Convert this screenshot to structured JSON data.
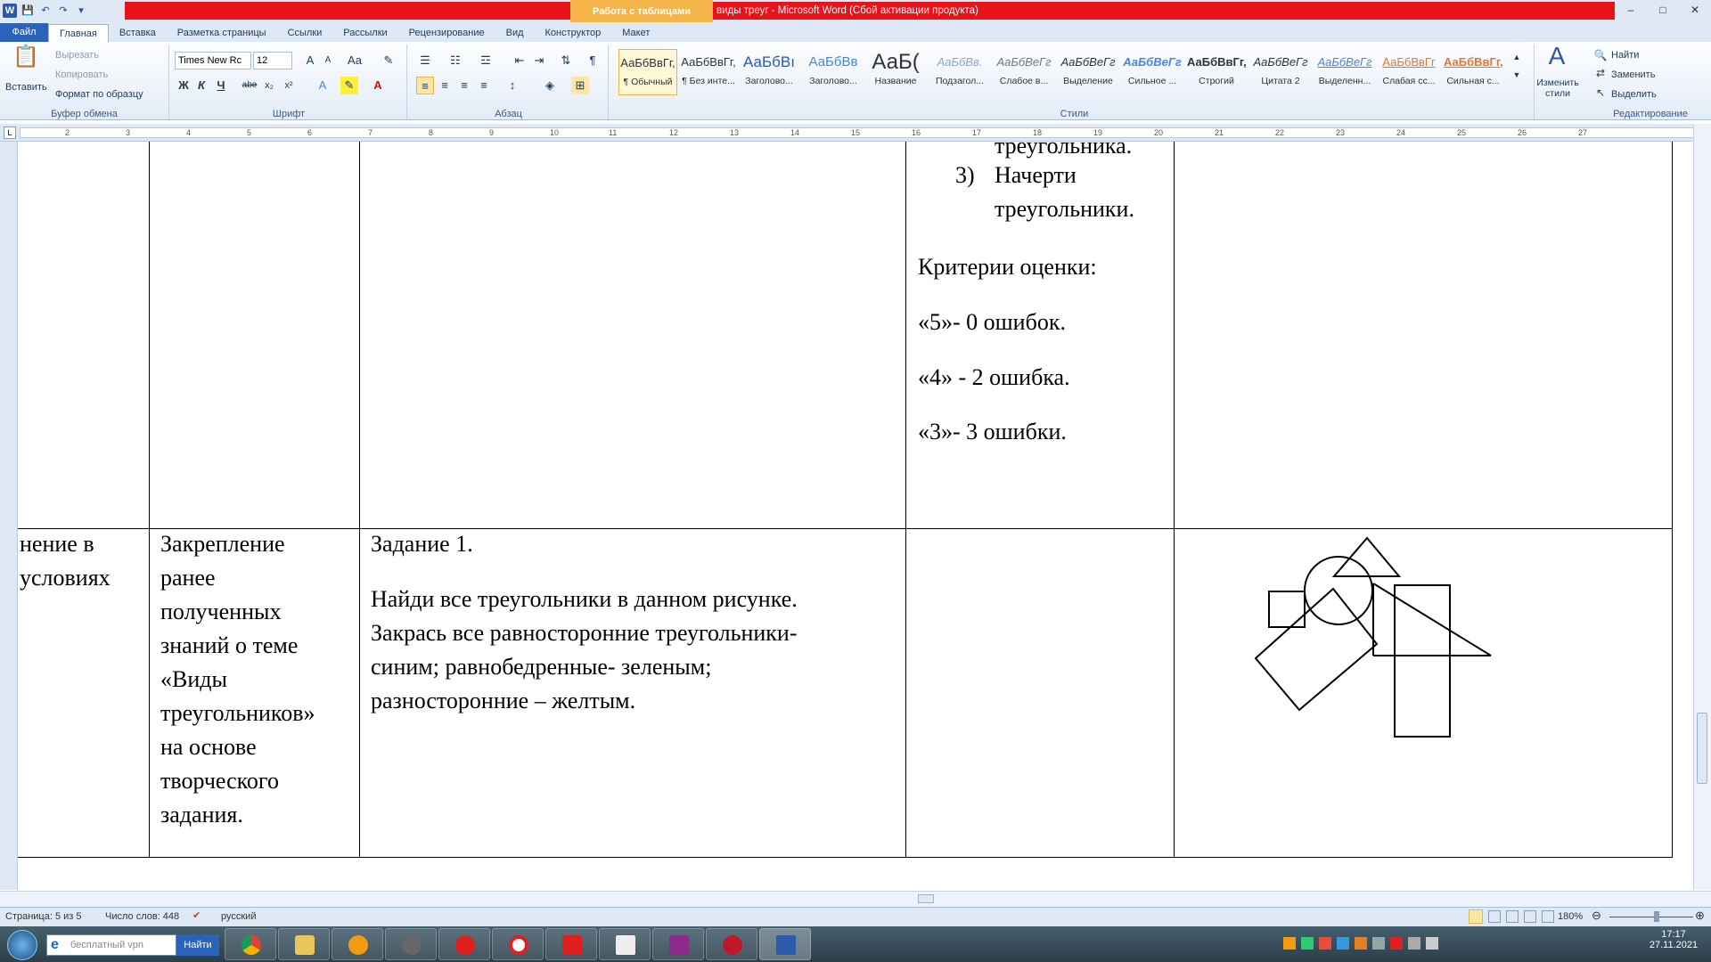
{
  "window": {
    "context_tab": "Работа с таблицами",
    "title": "виды треуг  -  Microsoft Word (Сбой активации продукта)",
    "controls": {
      "minimize": "–",
      "maximize": "□",
      "close": "✕"
    }
  },
  "ribbon_tabs": [
    "Файл",
    "Главная",
    "Вставка",
    "Разметка страницы",
    "Ссылки",
    "Рассылки",
    "Рецензирование",
    "Вид",
    "Конструктор",
    "Макет"
  ],
  "clipboard": {
    "paste": "Вставить",
    "cut": "Вырезать",
    "copy": "Копировать",
    "format_painter": "Формат по образцу",
    "label": "Буфер обмена"
  },
  "font": {
    "name": "Times New Rc",
    "size": "12",
    "label": "Шрифт",
    "bold": "Ж",
    "italic": "К",
    "underline": "Ч",
    "strike": "abe",
    "sub": "x₂",
    "sup": "x²"
  },
  "paragraph": {
    "label": "Абзац"
  },
  "styles": {
    "label": "Стили",
    "items": [
      {
        "preview": "АаБбВвГг,",
        "name": "¶ Обычный"
      },
      {
        "preview": "АаБбВвГг,",
        "name": "¶ Без инте..."
      },
      {
        "preview": "АаБбВı",
        "name": "Заголово..."
      },
      {
        "preview": "АаБбВв",
        "name": "Заголово..."
      },
      {
        "preview": "АаБ(",
        "name": "Название"
      },
      {
        "preview": "АаБбВв.",
        "name": "Подзагол..."
      },
      {
        "preview": "АаБбВеГг",
        "name": "Слабое в..."
      },
      {
        "preview": "АаБбВеГг",
        "name": "Выделение"
      },
      {
        "preview": "АаБбВеГг",
        "name": "Сильное ..."
      },
      {
        "preview": "АаБбВвГг,",
        "name": "Строгий"
      },
      {
        "preview": "АаБбВеГг",
        "name": "Цитата 2"
      },
      {
        "preview": "АаБбВеГг",
        "name": "Выделенн..."
      },
      {
        "preview": "АаБбВвГг",
        "name": "Слабая сс..."
      },
      {
        "preview": "АаБбВвГг,",
        "name": "Сильная с..."
      }
    ],
    "change": "Изменить стили"
  },
  "editing": {
    "find": "Найти",
    "replace": "Заменить",
    "select": "Выделить",
    "label": "Редактирование"
  },
  "ruler_numbers": [
    "2",
    "3",
    "4",
    "5",
    "6",
    "7",
    "8",
    "9",
    "10",
    "11",
    "12",
    "13",
    "14",
    "15",
    "16",
    "17",
    "18",
    "19",
    "20",
    "21",
    "22",
    "23",
    "24",
    "25",
    "26",
    "27"
  ],
  "document": {
    "top_row": {
      "partial": "треугольника.",
      "item3_num": "3)",
      "item3_line1": "Начерти",
      "item3_line2": "треугольники.",
      "criteria_title": "Критерии оценки:",
      "c5": "«5»- 0 ошибок.",
      "c4": "«4» - 2 ошибка.",
      "c3": "«3»- 3 ошибки."
    },
    "bottom_row": {
      "col1_line1": "нение в",
      "col1_line2": "условиях",
      "col2": [
        "Закрепление",
        "ранее",
        "полученных",
        "знаний о теме",
        "«Виды",
        "треугольников»",
        "на основе",
        "творческого",
        "задания."
      ],
      "task_title": "Задание 1.",
      "task_lines": [
        "Найди все треугольники в данном рисунке.",
        "Закрась все равносторонние треугольники-",
        "синим; равнобедренные- зеленым;",
        "разносторонние – желтым."
      ]
    }
  },
  "status": {
    "page": "Страница: 5 из 5",
    "words": "Число слов: 448",
    "lang": "русский",
    "zoom": "180%"
  },
  "taskbar": {
    "search_placeholder": "бесплатный vpn",
    "search_button": "Найти",
    "time": "17:17",
    "date": "27.11.2021"
  }
}
